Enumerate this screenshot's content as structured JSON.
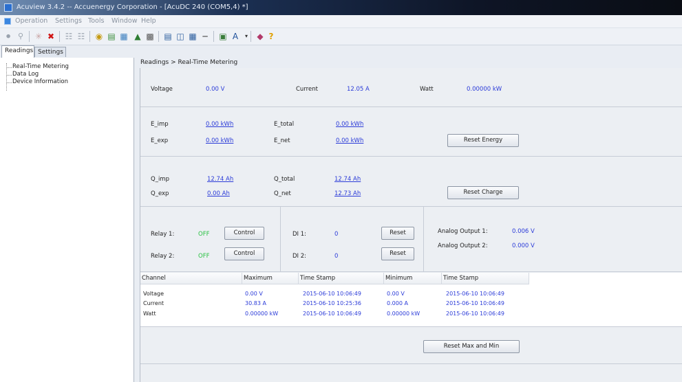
{
  "window": {
    "title": "Acuview 3.4.2 -- Accuenergy Corporation - [AcuDC 240 (COM5,4) *]"
  },
  "menu": [
    "Operation",
    "Settings",
    "Tools",
    "Window",
    "Help"
  ],
  "toolbar_icons": [
    "bulb-off-icon",
    "bulb-on-icon",
    "sparkle-icon",
    "disconnect-icon",
    "network-icon",
    "network-disconnect-icon",
    "device-icon",
    "meter-icon",
    "chart-icon",
    "scan-icon",
    "calculator-icon",
    "table-icon",
    "panel-icon",
    "grid-icon",
    "minimize-icon",
    "export-icon",
    "font-icon",
    "dropdown-icon",
    "book-icon",
    "help-icon"
  ],
  "tabs": {
    "readings": "Readings",
    "settings": "Settings"
  },
  "tree": [
    "Real-Time Metering",
    "Data Log",
    "Device Information"
  ],
  "breadcrumb": "Readings > Real-Time Metering",
  "realtime": {
    "voltage_label": "Voltage",
    "voltage_value": "0.00 V",
    "current_label": "Current",
    "current_value": "12.05 A",
    "watt_label": "Watt",
    "watt_value": "0.00000 kW"
  },
  "energy": {
    "e_imp_label": "E_imp",
    "e_imp_value": "0.00 kWh",
    "e_exp_label": "E_exp",
    "e_exp_value": "0.00 kWh",
    "e_total_label": "E_total",
    "e_total_value": "0.00 kWh",
    "e_net_label": "E_net",
    "e_net_value": "0.00 kWh",
    "reset_label": "Reset Energy"
  },
  "charge": {
    "q_imp_label": "Q_imp",
    "q_imp_value": "12.74 Ah",
    "q_exp_label": "Q_exp",
    "q_exp_value": "0.00 Ah",
    "q_total_label": "Q_total",
    "q_total_value": "12.74 Ah",
    "q_net_label": "Q_net",
    "q_net_value": "12.73 Ah",
    "reset_label": "Reset Charge"
  },
  "io": {
    "relay1_label": "Relay 1:",
    "relay1_state": "OFF",
    "relay1_button": "Control",
    "relay2_label": "Relay 2:",
    "relay2_state": "OFF",
    "relay2_button": "Control",
    "di1_label": "DI 1:",
    "di1_value": "0",
    "di1_button": "Reset",
    "di2_label": "DI 2:",
    "di2_value": "0",
    "di2_button": "Reset",
    "ao1_label": "Analog Output 1:",
    "ao1_value": "0.006 V",
    "ao2_label": "Analog Output 2:",
    "ao2_value": "0.000 V"
  },
  "table": {
    "headers": [
      "Channel",
      "Maximum",
      "Time Stamp",
      "Minimum",
      "Time Stamp"
    ],
    "rows": [
      [
        "Voltage",
        "0.00 V",
        "2015-06-10 10:06:49",
        "0.00 V",
        "2015-06-10 10:06:49"
      ],
      [
        "Current",
        "30.83 A",
        "2015-06-10 10:25:36",
        "0.000 A",
        "2015-06-10 10:06:49"
      ],
      [
        "Watt",
        "0.00000 kW",
        "2015-06-10 10:06:49",
        "0.00000 kW",
        "2015-06-10 10:06:49"
      ]
    ]
  },
  "reset_max_min": "Reset Max and Min",
  "colors": {
    "value_blue": "#2a3ad8",
    "state_green": "#29c142"
  }
}
